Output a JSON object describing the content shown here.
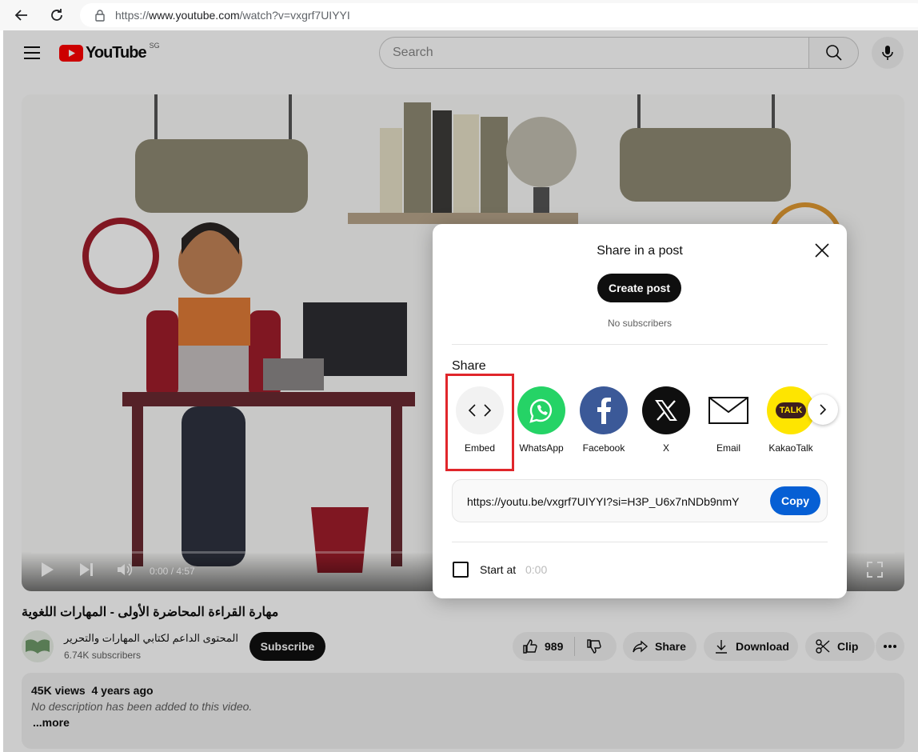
{
  "browser": {
    "url_prefix": "https://",
    "url_host": "www.youtube.com",
    "url_path": "/watch?v=vxgrf7UIYYI"
  },
  "header": {
    "logo_text": "YouTube",
    "country_code": "SG",
    "search_placeholder": "Search"
  },
  "player": {
    "current_time": "0:00",
    "duration": "/ 4:57",
    "progress": 0
  },
  "video": {
    "title": "مهارة القراءة المحاضرة الأولى - المهارات اللغوية",
    "channel_name": "المحتوى الداعم لكتابي المهارات والتحرير",
    "subscribers": "6.74K subscribers",
    "subscribe_label": "Subscribe",
    "likes": "989",
    "share_label": "Share",
    "download_label": "Download",
    "clip_label": "Clip",
    "views": "45K views",
    "age": "4 years ago",
    "description": "No description has been added to this video.",
    "more_label": "...more"
  },
  "dialog": {
    "title": "Share in a post",
    "create_post_label": "Create post",
    "no_subscribers": "No subscribers",
    "share_heading": "Share",
    "targets": [
      {
        "label": "Embed",
        "icon": "embed-icon"
      },
      {
        "label": "WhatsApp",
        "icon": "whatsapp-icon"
      },
      {
        "label": "Facebook",
        "icon": "facebook-icon"
      },
      {
        "label": "X",
        "icon": "x-icon"
      },
      {
        "label": "Email",
        "icon": "email-icon"
      },
      {
        "label": "KakaoTalk",
        "icon": "kakaotalk-icon",
        "badge": "TALK"
      }
    ],
    "link": "https://youtu.be/vxgrf7UIYYI?si=H3P_U6x7nNDb9nmY",
    "copy_label": "Copy",
    "start_at_label": "Start at",
    "start_at_value": "0:00",
    "start_at_checked": false
  },
  "colors": {
    "youtube_red": "#ff0000",
    "copy_blue": "#065fd4",
    "whatsapp_green": "#25d366",
    "facebook_blue": "#3b5998",
    "kakao_yellow": "#fee500",
    "highlight_red": "#e0262b"
  }
}
